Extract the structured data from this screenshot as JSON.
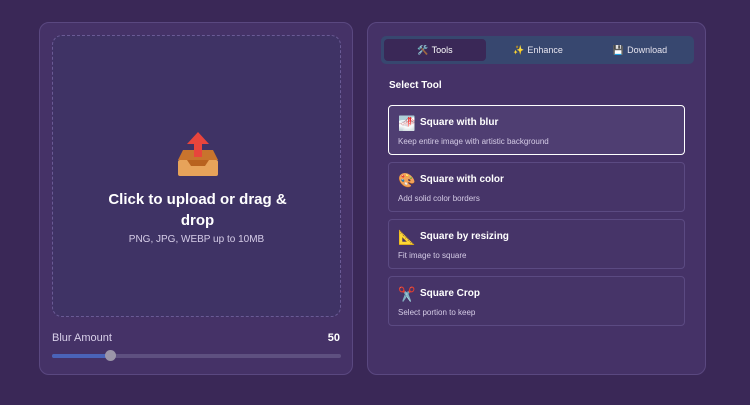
{
  "upload": {
    "title": "Click to upload or drag & drop",
    "subtitle": "PNG, JPG, WEBP up to 10MB",
    "icon": "inbox-upload-icon"
  },
  "blur": {
    "label": "Blur Amount",
    "value": "50",
    "fraction": 0.2
  },
  "tabs": [
    {
      "label": "Tools",
      "icon": "tools-icon",
      "glyph": "🛠️",
      "active": true
    },
    {
      "label": "Enhance",
      "icon": "sparkles-icon",
      "glyph": "✨",
      "active": false
    },
    {
      "label": "Download",
      "icon": "floppy-disk-icon",
      "glyph": "💾",
      "active": false
    }
  ],
  "section_title": "Select Tool",
  "tools": [
    {
      "title": "Square with blur",
      "desc": "Keep entire image with artistic background",
      "icon": "landscape-image-icon",
      "glyph": "🌁",
      "selected": true
    },
    {
      "title": "Square with color",
      "desc": "Add solid color borders",
      "icon": "palette-icon",
      "glyph": "🎨",
      "selected": false
    },
    {
      "title": "Square by resizing",
      "desc": "Fit image to square",
      "icon": "triangle-ruler-icon",
      "glyph": "📐",
      "selected": false
    },
    {
      "title": "Square Crop",
      "desc": "Select portion to keep",
      "icon": "scissors-icon",
      "glyph": "✂️",
      "selected": false
    }
  ],
  "colors": {
    "background": "#3a2857",
    "panel": "#453267",
    "tab_bar": "#37476f",
    "slider_fill": "#4a63b8"
  }
}
